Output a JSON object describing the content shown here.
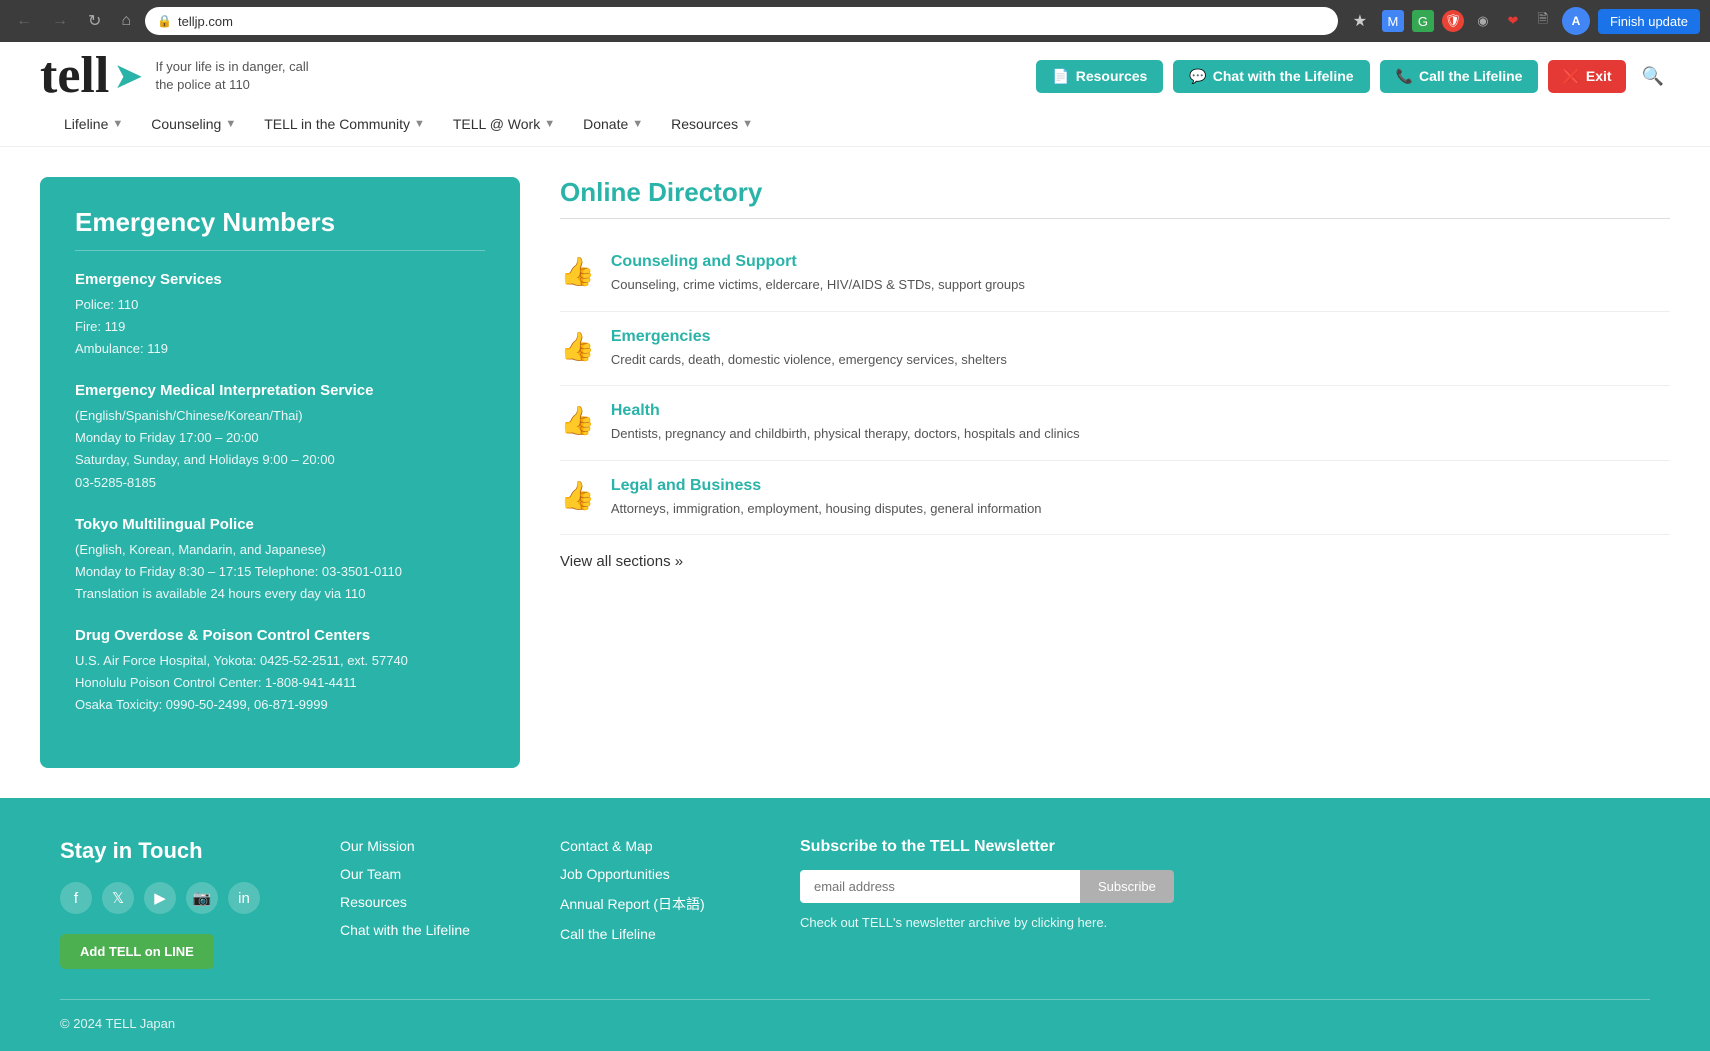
{
  "browser": {
    "url": "telljp.com",
    "finish_update_label": "Finish update"
  },
  "header": {
    "logo": "tell",
    "tagline": "If your life is in danger, call the police at 110",
    "buttons": {
      "resources": "Resources",
      "chat": "Chat with the Lifeline",
      "call": "Call the Lifeline",
      "exit": "Exit"
    },
    "nav": [
      {
        "label": "Lifeline",
        "has_dropdown": true
      },
      {
        "label": "Counseling",
        "has_dropdown": true
      },
      {
        "label": "TELL in the Community",
        "has_dropdown": true
      },
      {
        "label": "TELL @ Work",
        "has_dropdown": true
      },
      {
        "label": "Donate",
        "has_dropdown": true
      },
      {
        "label": "Resources",
        "has_dropdown": true
      }
    ]
  },
  "emergency": {
    "title": "Emergency Numbers",
    "groups": [
      {
        "title": "Emergency Services",
        "lines": [
          "Police: 110",
          "Fire: 119",
          "Ambulance: 119"
        ]
      },
      {
        "title": "Emergency Medical Interpretation Service",
        "lines": [
          "(English/Spanish/Chinese/Korean/Thai)",
          "Monday to Friday 17:00 – 20:00",
          "Saturday, Sunday, and Holidays 9:00 – 20:00",
          "03-5285-8185"
        ]
      },
      {
        "title": "Tokyo Multilingual Police",
        "lines": [
          "(English, Korean, Mandarin, and Japanese)",
          "Monday to Friday 8:30 – 17:15 Telephone: 03-3501-0110",
          "Translation is available 24 hours every day via 110"
        ]
      },
      {
        "title": "Drug Overdose & Poison Control Centers",
        "lines": [
          "U.S. Air Force Hospital, Yokota: 0425-52-2511, ext. 57740",
          "Honolulu Poison Control Center: 1-808-941-4411",
          "Osaka Toxicity: 0990-50-2499, 06-871-9999"
        ]
      }
    ]
  },
  "directory": {
    "title": "Online Directory",
    "items": [
      {
        "title": "Counseling and Support",
        "desc": "Counseling, crime victims, eldercare, HIV/AIDS & STDs, support groups"
      },
      {
        "title": "Emergencies",
        "desc": "Credit cards, death, domestic violence, emergency services, shelters"
      },
      {
        "title": "Health",
        "desc": "Dentists, pregnancy and childbirth, physical therapy, doctors, hospitals and clinics"
      },
      {
        "title": "Legal and Business",
        "desc": "Attorneys, immigration, employment, housing disputes, general information"
      }
    ],
    "view_all": "View all sections »"
  },
  "footer": {
    "stay_in_touch": "Stay in Touch",
    "add_tell_label": "Add TELL on LINE",
    "links_col1": [
      {
        "label": "Our Mission"
      },
      {
        "label": "Our Team"
      },
      {
        "label": "Resources"
      },
      {
        "label": "Chat with the Lifeline"
      }
    ],
    "links_col2": [
      {
        "label": "Contact & Map"
      },
      {
        "label": "Job Opportunities"
      },
      {
        "label": "Annual Report (日本語)"
      },
      {
        "label": "Call the Lifeline"
      }
    ],
    "newsletter": {
      "title": "Subscribe to the TELL Newsletter",
      "placeholder": "email address",
      "subscribe_label": "Subscribe",
      "archive_text": "Check out TELL's newsletter archive by clicking here."
    },
    "copyright": "© 2024 TELL Japan"
  }
}
